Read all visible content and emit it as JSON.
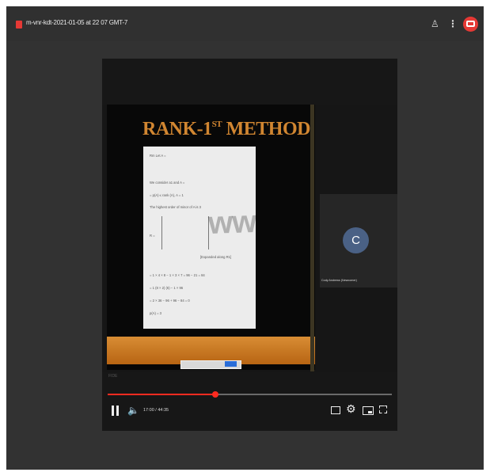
{
  "app": {
    "file_title": "m-vnr-kdt-2021-01-05 at 22 07 GMT-7",
    "top_actions": {
      "share_icon": "share-person-icon",
      "more_icon": "more-vertical-icon",
      "record_icon": "record-video-icon"
    }
  },
  "video": {
    "slide_title": "RANK-1",
    "slide_title_superscript": "ST",
    "slide_title_suffix": "METHOD",
    "watermark": "www.italy",
    "paper_lines": [
      "Rm   Let A =",
      "We consider a1 and  A =",
      "= p(A) ≤ rank (A), A = 1",
      "The highest order of minor of A is 3",
      "R =",
      "[Expanded along R1]",
      "= 1 × 4 × 8 − 1 × 3 × 7 = 96 − 21 = 84",
      "= 1 (8 × 2) (6) − 1 × 96",
      "= 2 × 36 − 96 + 96 − 84 = 0",
      "p(A) = 3"
    ],
    "participant": {
      "initial": "C",
      "name": "Cody Andrews (Newcomer)"
    },
    "progress": 0.38,
    "progress_label": "FIDE",
    "time_label": "17:00 / 44:35",
    "controls": {
      "pause_icon": "pause-icon",
      "volume_icon": "volume-icon",
      "captions_icon": "captions-icon",
      "settings_icon": "gear-icon",
      "miniplayer_icon": "miniplayer-icon",
      "fullscreen_icon": "fullscreen-icon"
    }
  }
}
